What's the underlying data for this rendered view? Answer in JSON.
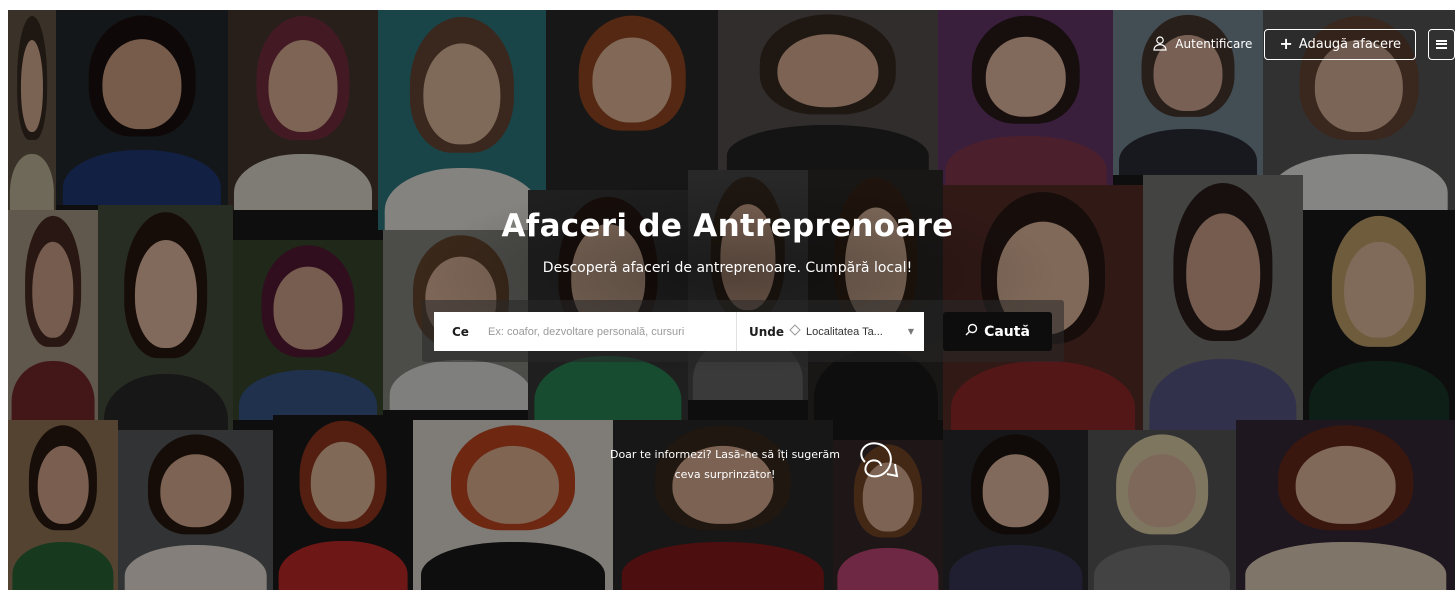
{
  "hero": {
    "title": "Afaceri de Antreprenoare",
    "subtitle": "Descoperă afaceri de antreprenoare. Cumpără local!"
  },
  "nav": {
    "login_label": "Autentificare",
    "add_business_label": "Adaugă afacere",
    "menu_icon": "hamburger-menu-icon",
    "login_icon": "user-icon"
  },
  "search": {
    "what_label": "Ce",
    "what_placeholder": "Ex: coafor, dezvoltare personală, cursuri",
    "where_label": "Unde",
    "where_value": "Localitatea Ta...",
    "where_icon": "location-diamond-icon",
    "button_label": "Caută",
    "button_icon": "search-icon"
  },
  "surprise": {
    "line1": "Doar te informezi? Lasă-ne să îți sugerăm",
    "line2": "ceva surprinzător!",
    "icon": "swirl-arrow-icon"
  },
  "colors": {
    "button_bg": "#0d0d0d",
    "text_on_dark": "#ffffff"
  }
}
